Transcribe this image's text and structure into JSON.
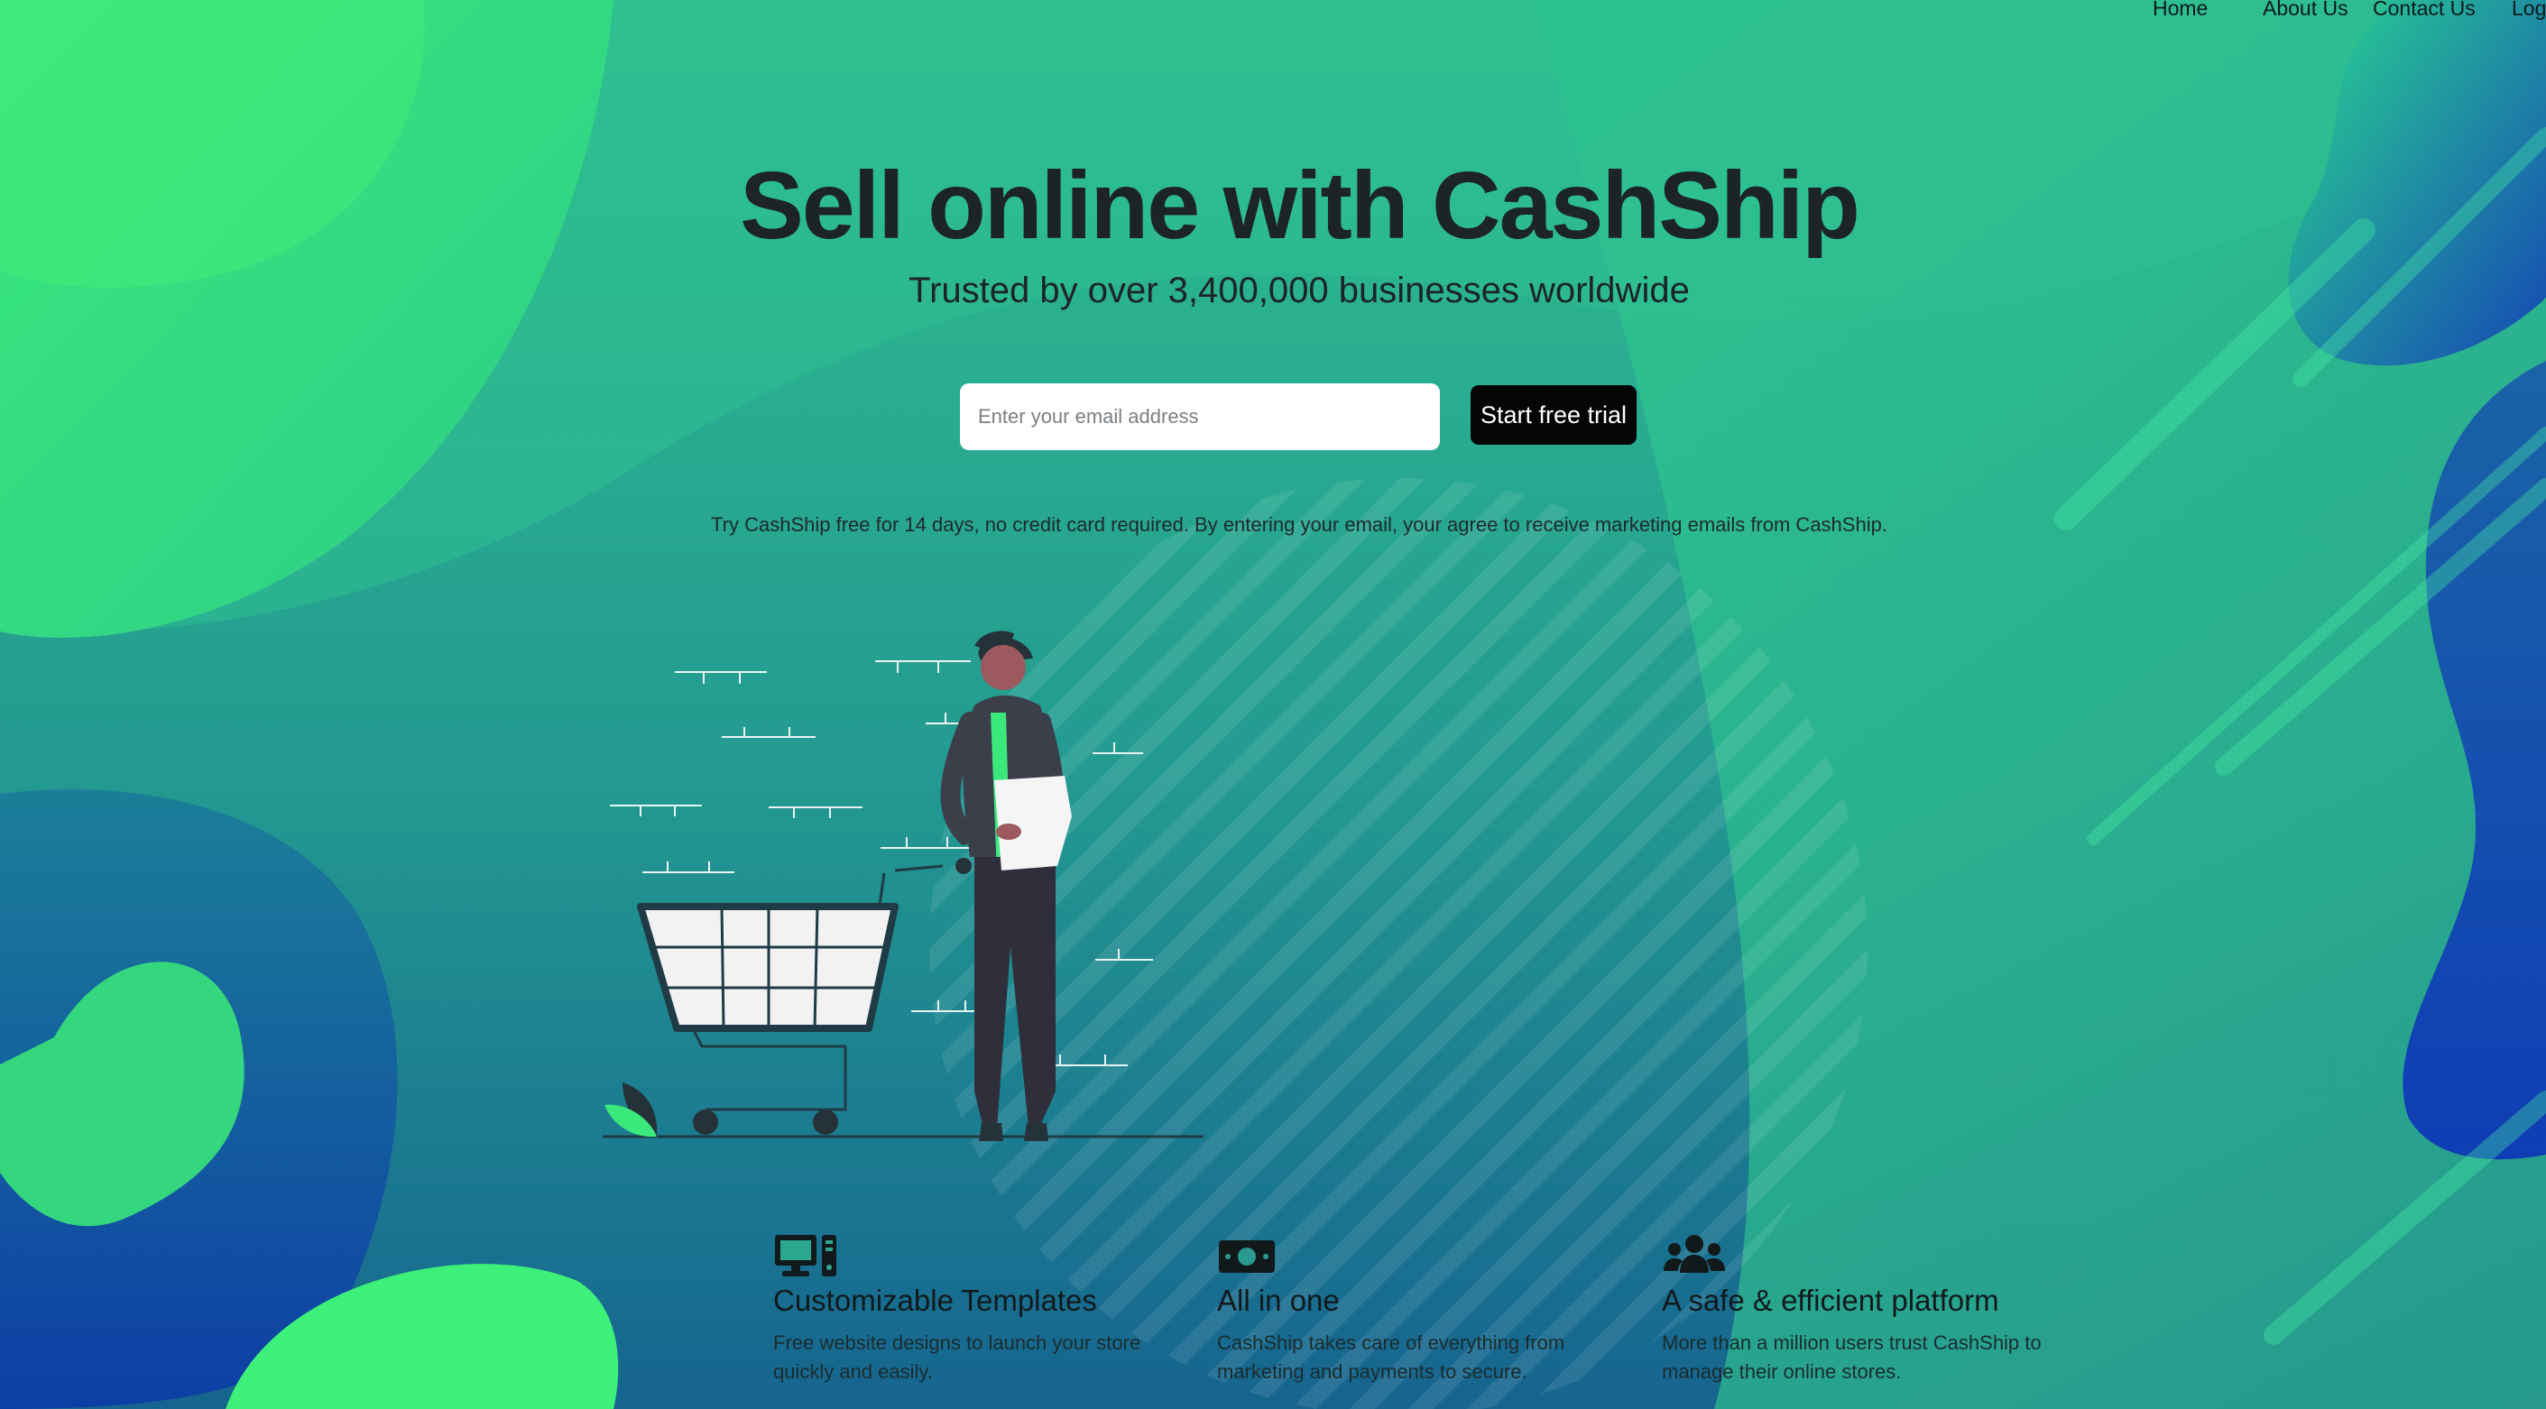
{
  "nav": {
    "items": [
      "Home",
      "About Us",
      "Contact Us",
      "Log"
    ]
  },
  "hero": {
    "title": "Sell online with CashShip",
    "subtitle": "Trusted by over 3,400,000 businesses worldwide"
  },
  "signup": {
    "email_placeholder": "Enter your email address",
    "email_value": "",
    "button_label": "Start free trial",
    "disclaimer": "Try CashShip free for 14 days, no credit card required. By entering your email, your agree to receive marketing emails from CashShip."
  },
  "features": [
    {
      "icon": "desktop-computer-icon",
      "title": "Customizable Templates",
      "text": "Free website designs to launch your store quickly and easily."
    },
    {
      "icon": "money-bill-icon",
      "title": "All in one",
      "text": "CashShip takes care of everything from marketing and payments to secure."
    },
    {
      "icon": "users-group-icon",
      "title": "A safe & efficient platform",
      "text": "More than a million users trust CashShip to manage their online stores."
    }
  ],
  "colors": {
    "background_top": "#2fc58f",
    "background_bottom": "#17738f",
    "accent_green": "#3df07a",
    "accent_blue": "#1141b8",
    "button_bg": "#050505",
    "text_dark": "#1c2426"
  }
}
